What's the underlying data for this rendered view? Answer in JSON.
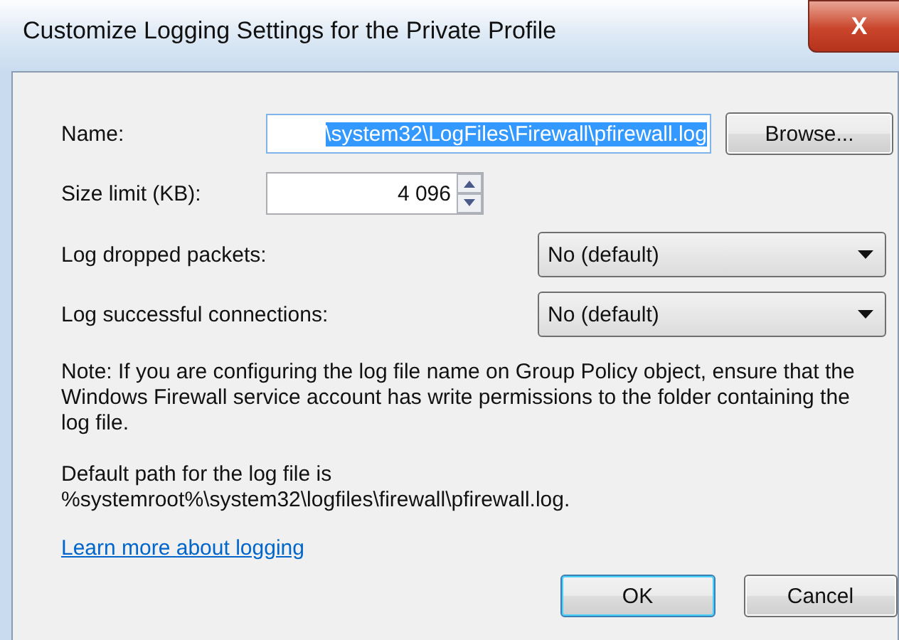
{
  "window": {
    "title": "Customize Logging Settings for the Private Profile",
    "close": "X"
  },
  "name": {
    "label": "Name:",
    "value": "\\system32\\LogFiles\\Firewall\\pfirewall.log",
    "text_selected": true
  },
  "browse": "Browse...",
  "size": {
    "label": "Size limit (KB):",
    "value": "4 096"
  },
  "dropdowns": [
    {
      "label": "Log dropped packets:",
      "value": "No (default)"
    },
    {
      "label": "Log successful connections:",
      "value": "No (default)"
    }
  ],
  "note": "Note: If you are configuring the log file name on Group Policy object, ensure that the Windows Firewall service account has write permissions to the folder containing the log file.",
  "default_path": [
    "Default path for the log file is",
    "%systemroot%\\system32\\logfiles\\firewall\\pfirewall.log."
  ],
  "link": "Learn more about logging",
  "buttons": [
    {
      "label": "OK",
      "default": true
    },
    {
      "label": "Cancel",
      "default": false
    }
  ]
}
